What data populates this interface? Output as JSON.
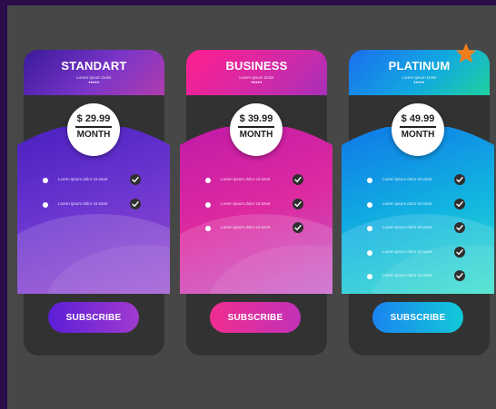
{
  "plans": [
    {
      "name": "STANDART",
      "subtitle": "Lorem Ipsum Dolor",
      "dots": "•••••",
      "price": "$ 29.99",
      "period": "MONTH",
      "features": [
        "Lorem ipsum dolor sit amet",
        "Lorem ipsum dolor sit amet"
      ],
      "button_label": "SUBSCRIBE"
    },
    {
      "name": "BUSINESS",
      "subtitle": "Lorem Ipsum Dolor",
      "dots": "•••••",
      "price": "$ 39.99",
      "period": "MONTH",
      "features": [
        "Lorem ipsum dolor sit amet",
        "Lorem ipsum dolor sit amet",
        "Lorem ipsum dolor sit amet"
      ],
      "button_label": "SUBSCRIBE"
    },
    {
      "name": "PLATINUM",
      "subtitle": "Lorem Ipsum Dolor",
      "dots": "•••••",
      "price": "$ 49.99",
      "period": "MONTH",
      "features": [
        "Lorem ipsum dolor sit amet",
        "Lorem ipsum dolor sit amet",
        "Lorem ipsum dolor sit amet",
        "Lorem ipsum dolor sit amet",
        "Lorem ipsum dolor sit amet"
      ],
      "button_label": "SUBSCRIBE"
    }
  ],
  "badge": {
    "icon": "star-icon",
    "color": "#f07f1c"
  },
  "colors": {
    "background": "#2a0c4a",
    "frame": "#474747",
    "card": "#323232",
    "standart_accent": "#5b1fd6",
    "business_accent": "#f02d90",
    "platinum_accent": "#1a84f0"
  }
}
